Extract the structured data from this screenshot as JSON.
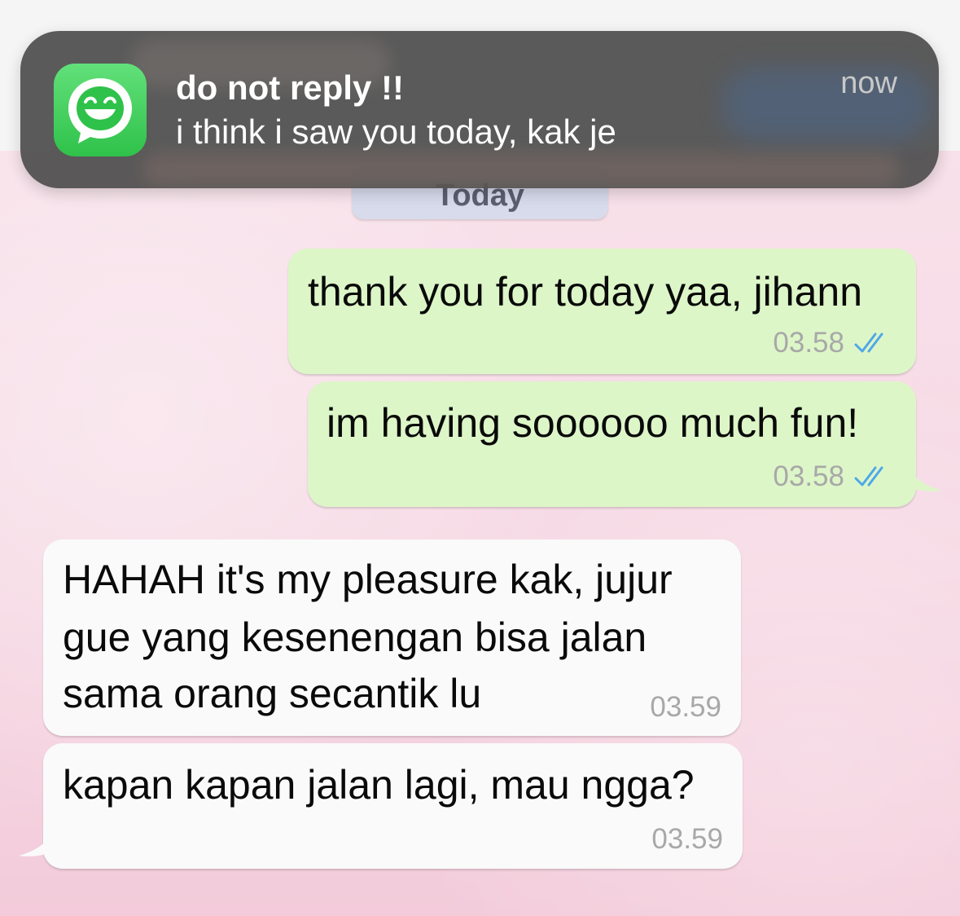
{
  "notification": {
    "app_icon": "whatsapp-smile-icon",
    "title": "do not reply !!",
    "body": "i think i saw you today, kak je",
    "time": "now"
  },
  "date_chip": {
    "label": "Today"
  },
  "messages": [
    {
      "direction": "outgoing",
      "text": "thank you for today yaa, jihann",
      "time": "03.58",
      "status_icon": "double-check-icon"
    },
    {
      "direction": "outgoing",
      "text": "im having soooooo much fun!",
      "time": "03.58",
      "status_icon": "double-check-icon"
    },
    {
      "direction": "incoming",
      "lines": [
        "HAHAH it's my pleasure kak, jujur",
        "gue yang kesenengan bisa jalan",
        "sama orang secantik lu"
      ],
      "time": "03.59"
    },
    {
      "direction": "incoming",
      "text": "kapan kapan jalan lagi, mau ngga?",
      "time": "03.59"
    }
  ],
  "colors": {
    "outgoing_bubble": "#ddf6c8",
    "incoming_bubble": "#fafafa",
    "chat_background": "#f7dce6",
    "read_ticks": "#4fa8e8",
    "notification_bg": "#4e4e4e",
    "app_icon_green": "#35c84f"
  }
}
